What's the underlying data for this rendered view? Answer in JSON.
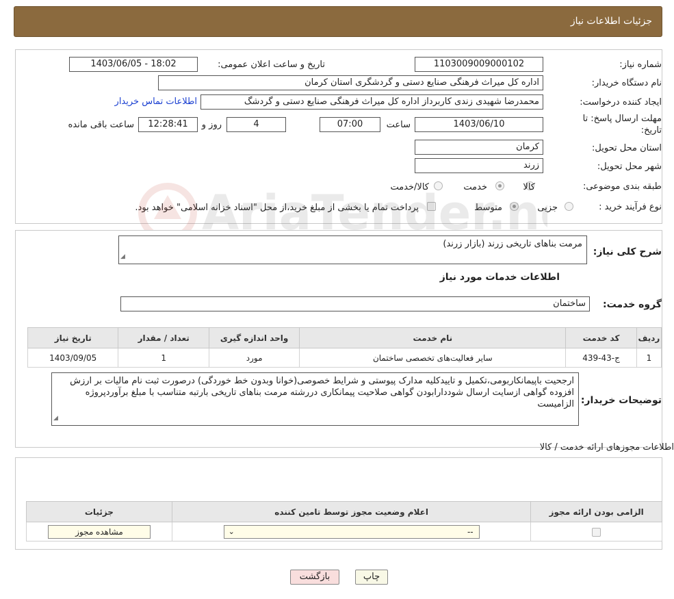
{
  "header": {
    "title": "جزئیات اطلاعات نیاز"
  },
  "need": {
    "number_label": "شماره نیاز:",
    "number_value": "1103009009000102",
    "announce_label": "تاریخ و ساعت اعلان عمومی:",
    "announce_value": "1403/06/05 - 18:02",
    "buyer_label": "نام دستگاه خریدار:",
    "buyer_value": "اداره کل میراث فرهنگی  صنایع دستی و گردشگری استان کرمان",
    "creator_label": "ایجاد کننده درخواست:",
    "creator_value": "محمدرضا شهیدی زندی کاربرداز اداره کل میراث فرهنگی  صنایع دستی و گردشگ",
    "contact_link": "اطلاعات تماس خریدار",
    "deadline_label_1": "مهلت ارسال پاسخ: تا",
    "deadline_label_2": "تاریخ:",
    "deadline_date": "1403/06/10",
    "time_label": "ساعت",
    "deadline_time": "07:00",
    "days_value": "4",
    "days_label": "روز و",
    "remaining_value": "12:28:41",
    "remaining_label": "ساعت باقی مانده",
    "province_label": "استان محل تحویل:",
    "province_value": "کرمان",
    "city_label": "شهر محل تحویل:",
    "city_value": "زرند",
    "category_label": "طبقه بندی موضوعی:",
    "category_options": [
      "کالا",
      "خدمت",
      "کالا/خدمت"
    ],
    "category_selected": "خدمت",
    "process_label": "نوع فرآیند خرید :",
    "process_options": [
      "جزیی",
      "متوسط"
    ],
    "process_selected": "متوسط",
    "payment_note": "پرداخت تمام یا بخشی از مبلغ خرید،از محل \"اسناد خزانه اسلامی\" خواهد بود."
  },
  "summary": {
    "label": "شرح کلی نیاز:",
    "value": "مرمت بناهای تاریخی زرند (بازار زرند)",
    "services_title": "اطلاعات خدمات مورد نیاز",
    "group_label": "گروه خدمت:",
    "group_value": "ساختمان"
  },
  "services_table": {
    "headers": [
      "ردیف",
      "کد خدمت",
      "نام خدمت",
      "واحد اندازه گیری",
      "تعداد / مقدار",
      "تاریخ نیاز"
    ],
    "rows": [
      [
        "1",
        "ج-43-439",
        "سایر فعالیت‌های تخصصی ساختمان",
        "مورد",
        "1",
        "1403/09/05"
      ]
    ]
  },
  "buyer_notes": {
    "label": "توضیحات خریدار:",
    "value": "ارجحیت باپیمانکاربومی،تکمیل و تاییدکلیه مدارک پیوستی و شرایط خصوصی(خوانا وبدون خط خوردگی) درصورت ثبت نام مالیات بر ارزش افزوده گواهی ازسایت ارسال شوددارابودن گواهی صلاحیت پیمانکاری دررشته مرمت بناهای تاریخی بارتبه متناسب با مبلغ برآوردپروژه الزامیست"
  },
  "permits": {
    "title": "اطلاعات مجوزهای ارائه خدمت / کالا",
    "headers": [
      "الزامی بودن ارائه مجوز",
      "اعلام وضعیت مجوز توسط تامین کننده",
      "جزئیات"
    ],
    "select_value": "--",
    "view_button": "مشاهده مجوز"
  },
  "buttons": {
    "print": "چاپ",
    "back": "بازگشت"
  },
  "watermark_text": "AriaTender.neT"
}
